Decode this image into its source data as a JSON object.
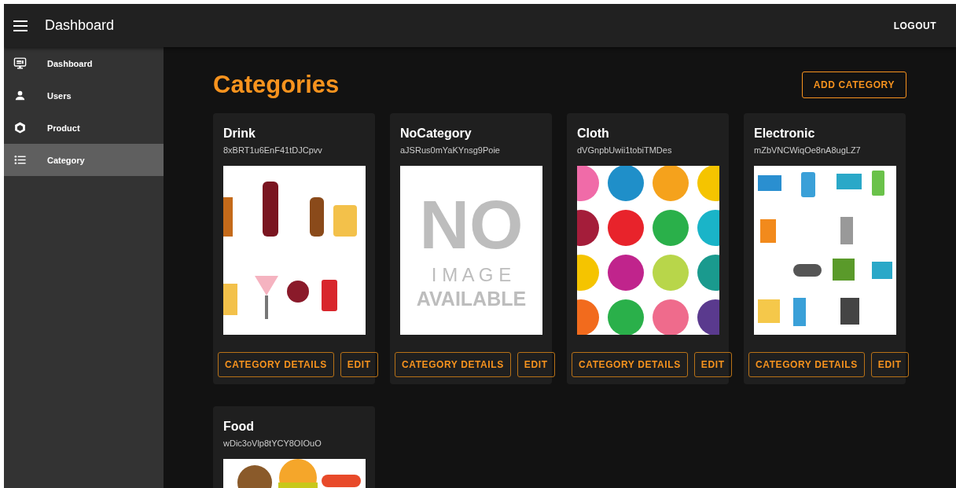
{
  "app_bar": {
    "title": "Dashboard",
    "action": "LOGOUT"
  },
  "sidebar": {
    "items": [
      {
        "label": "Dashboard",
        "selected": false
      },
      {
        "label": "Users",
        "selected": false
      },
      {
        "label": "Product",
        "selected": false
      },
      {
        "label": "Category",
        "selected": true
      }
    ]
  },
  "page": {
    "title": "Categories",
    "add_button": "ADD CATEGORY"
  },
  "cards": [
    {
      "name": "Drink",
      "id": "8xBRT1u6EnF41tDJCpvv",
      "image": {
        "kind": "picture"
      },
      "buttons": [
        "CATEGORY DETAILS",
        "EDIT"
      ]
    },
    {
      "name": "NoCategory",
      "id": "aJSRus0mYaKYnsg9Poie",
      "image": {
        "kind": "no_image",
        "lines": [
          "NO",
          "I M A G E",
          "AVAILABLE"
        ]
      },
      "buttons": [
        "CATEGORY DETAILS",
        "EDIT"
      ]
    },
    {
      "name": "Cloth",
      "id": "dVGnpbUwii1tobiTMDes",
      "image": {
        "kind": "picture"
      },
      "buttons": [
        "CATEGORY DETAILS",
        "EDIT"
      ]
    },
    {
      "name": "Electronic",
      "id": "mZbVNCWiqOe8nA8ugLZ7",
      "image": {
        "kind": "picture"
      },
      "buttons": [
        "CATEGORY DETAILS",
        "EDIT"
      ]
    },
    {
      "name": "Food",
      "id": "wDic3oVlp8tYCY8OIOuO",
      "image": {
        "kind": "picture"
      }
    }
  ]
}
